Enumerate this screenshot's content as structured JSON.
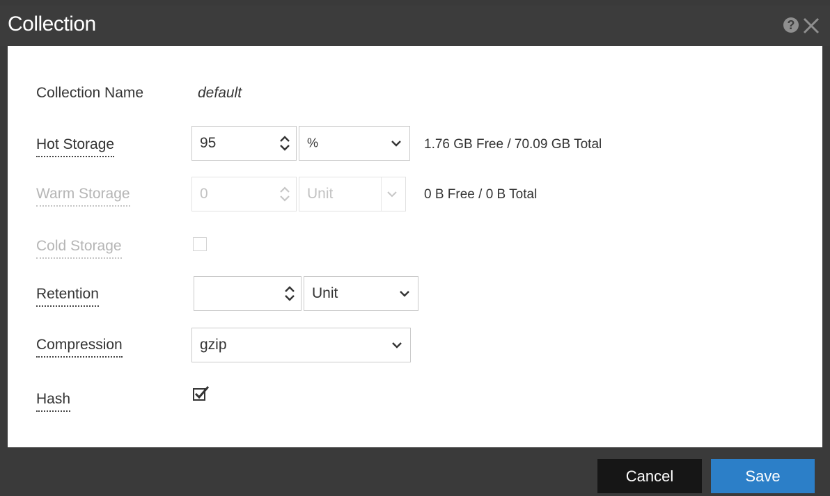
{
  "dialog": {
    "title": "Collection",
    "help_icon": "help-circle-icon",
    "close_icon": "close-icon"
  },
  "form": {
    "collection_name": {
      "label": "Collection Name",
      "value": "default"
    },
    "hot_storage": {
      "label": "Hot Storage",
      "value": "95",
      "unit": "%",
      "info": "1.76 GB Free / 70.09 GB Total"
    },
    "warm_storage": {
      "label": "Warm Storage",
      "value": "0",
      "unit": "Unit",
      "info": "0 B Free / 0 B Total",
      "disabled": true
    },
    "cold_storage": {
      "label": "Cold Storage",
      "checked": false,
      "disabled": true
    },
    "retention": {
      "label": "Retention",
      "value": "",
      "unit": "Unit"
    },
    "compression": {
      "label": "Compression",
      "value": "gzip"
    },
    "hash": {
      "label": "Hash",
      "checked": true
    }
  },
  "footer": {
    "cancel_label": "Cancel",
    "save_label": "Save"
  },
  "colors": {
    "titlebar": "#3c3c3c",
    "save_button": "#2c7fc8",
    "cancel_button": "#161616"
  }
}
